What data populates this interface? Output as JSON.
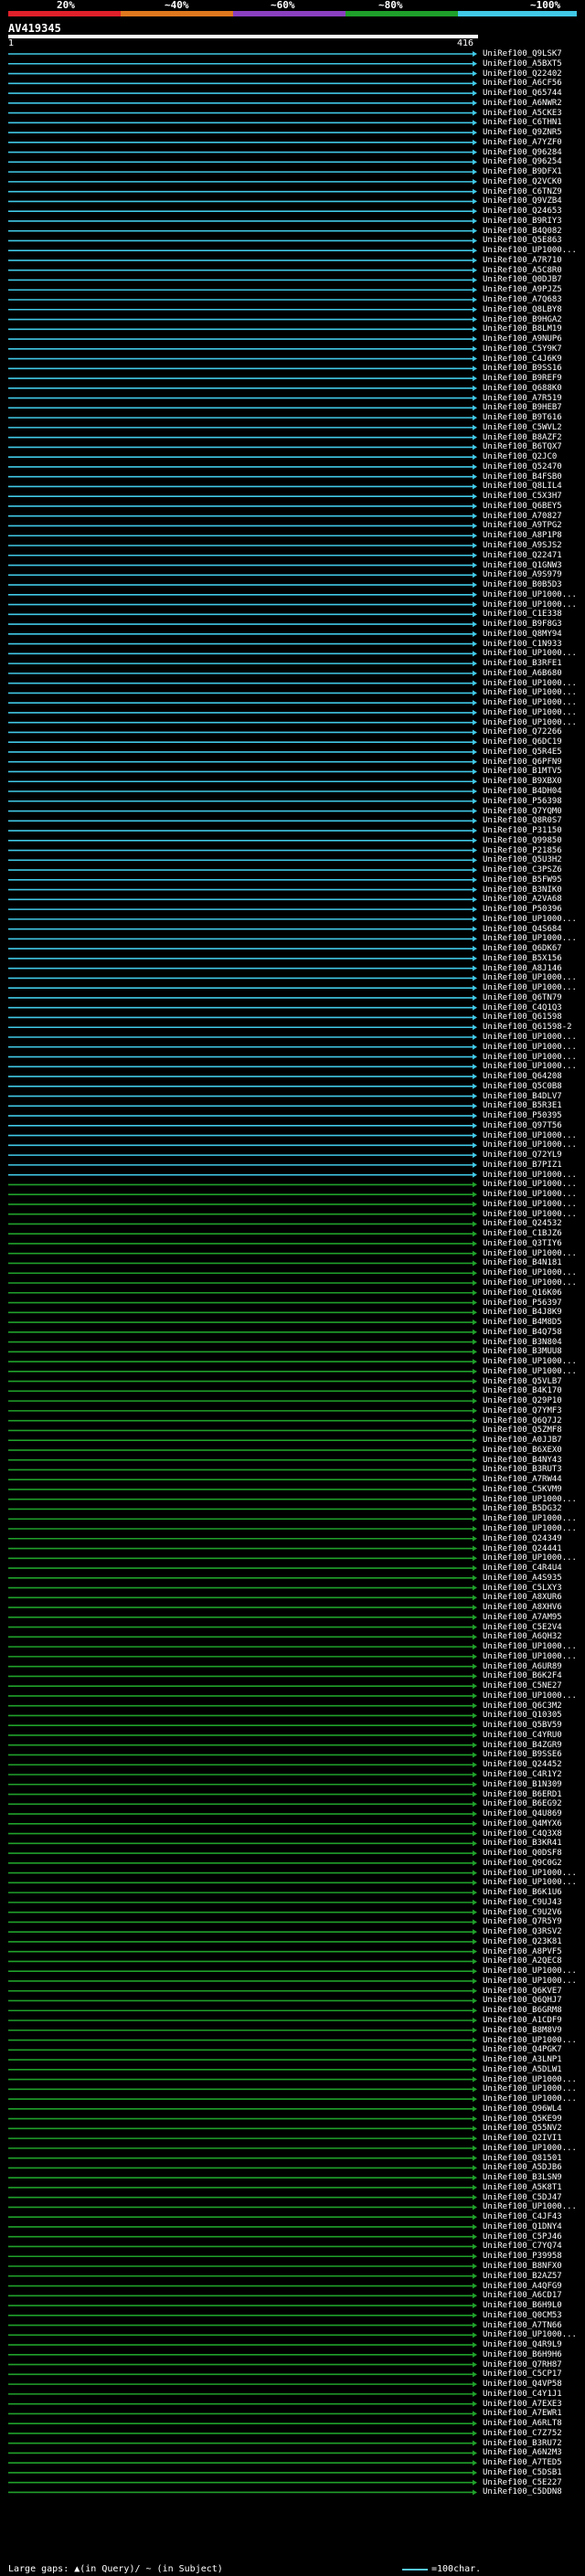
{
  "legend": {
    "labels": [
      "20%",
      "~40%",
      "~60%",
      "~80%",
      "~100%"
    ],
    "colors": [
      "#e0202a",
      "#e0781e",
      "#8a40c0",
      "#1fa02a",
      "#40c8e6"
    ]
  },
  "query": {
    "name": "AV419345",
    "start": "1",
    "end": "416"
  },
  "footer": {
    "gaps_text": "Large gaps: ▲(in Query)/ ~ (in Subject)",
    "scale_text": "=100char."
  },
  "hits": [
    "UniRef100_Q9LSK7",
    "UniRef100_A5BXT5",
    "UniRef100_Q22402",
    "UniRef100_A6CF56",
    "UniRef100_Q65744",
    "UniRef100_A6NWR2",
    "UniRef100_A5CKE3",
    "UniRef100_C6THN1",
    "UniRef100_Q9ZNR5",
    "UniRef100_A7YZF0",
    "UniRef100_Q96284",
    "UniRef100_Q96254",
    "UniRef100_B9DFX1",
    "UniRef100_Q2VCK0",
    "UniRef100_C6TNZ9",
    "UniRef100_Q9VZB4",
    "UniRef100_Q24653",
    "UniRef100_B9RIY3",
    "UniRef100_B4Q082",
    "UniRef100_Q5E863",
    "UniRef100_UP1000...",
    "UniRef100_A7R710",
    "UniRef100_A5C8R0",
    "UniRef100_Q0DJB7",
    "UniRef100_A9PJZ5",
    "UniRef100_A7Q683",
    "UniRef100_Q8LBY8",
    "UniRef100_B9HGA2",
    "UniRef100_B8LM19",
    "UniRef100_A9NUP6",
    "UniRef100_C5Y9K7",
    "UniRef100_C4J6K9",
    "UniRef100_B9SS16",
    "UniRef100_B9REF9",
    "UniRef100_Q688K0",
    "UniRef100_A7R519",
    "UniRef100_B9HEB7",
    "UniRef100_B9T616",
    "UniRef100_C5WVL2",
    "UniRef100_B8AZF2",
    "UniRef100_B6TQX7",
    "UniRef100_Q2JC0",
    "UniRef100_Q52470",
    "UniRef100_B4FSB0",
    "UniRef100_Q8LIL4",
    "UniRef100_C5X3H7",
    "UniRef100_Q6BEY5",
    "UniRef100_A70827",
    "UniRef100_A9TPG2",
    "UniRef100_A8P1P8",
    "UniRef100_A9SJS2",
    "UniRef100_Q22471",
    "UniRef100_Q1GNW3",
    "UniRef100_A9S979",
    "UniRef100_B0B5D3",
    "UniRef100_UP1000...",
    "UniRef100_UP1000...",
    "UniRef100_C1E338",
    "UniRef100_B9F8G3",
    "UniRef100_Q8MY94",
    "UniRef100_C1N933",
    "UniRef100_UP1000...",
    "UniRef100_B3RFE1",
    "UniRef100_A6B680",
    "UniRef100_UP1000...",
    "UniRef100_UP1000...",
    "UniRef100_UP1000...",
    "UniRef100_UP1000...",
    "UniRef100_UP1000...",
    "UniRef100_Q72266",
    "UniRef100_Q6DC19",
    "UniRef100_Q5R4E5",
    "UniRef100_Q6PFN9",
    "UniRef100_B1MTV5",
    "UniRef100_B9XBX0",
    "UniRef100_B4DH04",
    "UniRef100_P56398",
    "UniRef100_Q7YQM0",
    "UniRef100_Q8R0S7",
    "UniRef100_P31150",
    "UniRef100_Q99850",
    "UniRef100_P21856",
    "UniRef100_Q5U3H2",
    "UniRef100_C3PSZ6",
    "UniRef100_B5FW95",
    "UniRef100_B3NIK0",
    "UniRef100_A2VA68",
    "UniRef100_P50396",
    "UniRef100_UP1000...",
    "UniRef100_Q4S684",
    "UniRef100_UP1000...",
    "UniRef100_Q6DK67",
    "UniRef100_B5X156",
    "UniRef100_A8J146",
    "UniRef100_UP1000...",
    "UniRef100_UP1000...",
    "UniRef100_Q6TN79",
    "UniRef100_C4Q1Q3",
    "UniRef100_Q61598",
    "UniRef100_Q61598-2",
    "UniRef100_UP1000...",
    "UniRef100_UP1000...",
    "UniRef100_UP1000...",
    "UniRef100_UP1000...",
    "UniRef100_Q64208",
    "UniRef100_Q5C0B8",
    "UniRef100_B4DLV7",
    "UniRef100_B5R3E1",
    "UniRef100_P50395",
    "UniRef100_Q97T56",
    "UniRef100_UP1000...",
    "UniRef100_UP1000...",
    "UniRef100_Q72YL9",
    "UniRef100_B7PIZ1",
    "UniRef100_UP1000...",
    "UniRef100_UP1000...",
    "UniRef100_UP1000...",
    "UniRef100_UP1000...",
    "UniRef100_UP1000...",
    "UniRef100_Q24532",
    "UniRef100_C1BJZ6",
    "UniRef100_Q3TIY6",
    "UniRef100_UP1000...",
    "UniRef100_B4N181",
    "UniRef100_UP1000...",
    "UniRef100_UP1000...",
    "UniRef100_Q16K06",
    "UniRef100_P56397",
    "UniRef100_B4J8K9",
    "UniRef100_B4M8D5",
    "UniRef100_B4Q758",
    "UniRef100_B3N804",
    "UniRef100_B3MUU8",
    "UniRef100_UP1000...",
    "UniRef100_UP1000...",
    "UniRef100_Q5VLB7",
    "UniRef100_B4K170",
    "UniRef100_Q29P10",
    "UniRef100_Q7YMF3",
    "UniRef100_Q6Q7J2",
    "UniRef100_Q5ZMF8",
    "UniRef100_A0JJB7",
    "UniRef100_B6XEX0",
    "UniRef100_B4NY43",
    "UniRef100_B3RUT3",
    "UniRef100_A7RW44",
    "UniRef100_C5KVM9",
    "UniRef100_UP1000...",
    "UniRef100_B5DG32",
    "UniRef100_UP1000...",
    "UniRef100_UP1000...",
    "UniRef100_Q24349",
    "UniRef100_Q24441",
    "UniRef100_UP1000...",
    "UniRef100_C4R4U4",
    "UniRef100_A4S935",
    "UniRef100_C5LXY3",
    "UniRef100_A8XUR6",
    "UniRef100_A8XHV6",
    "UniRef100_A7AM95",
    "UniRef100_C5E2V4",
    "UniRef100_A6QH32",
    "UniRef100_UP1000...",
    "UniRef100_UP1000...",
    "UniRef100_A6UR89",
    "UniRef100_B6K2F4",
    "UniRef100_C5NE27",
    "UniRef100_UP1000...",
    "UniRef100_Q6C3M2",
    "UniRef100_Q10305",
    "UniRef100_Q5BV59",
    "UniRef100_C4YRU0",
    "UniRef100_B4ZGR9",
    "UniRef100_B9SSE6",
    "UniRef100_Q24452",
    "UniRef100_C4R1Y2",
    "UniRef100_B1N309",
    "UniRef100_B6ERD1",
    "UniRef100_B6EG92",
    "UniRef100_Q4U869",
    "UniRef100_Q4MYX6",
    "UniRef100_C4Q3X8",
    "UniRef100_B3KR41",
    "UniRef100_Q0DSF8",
    "UniRef100_Q9C0G2",
    "UniRef100_UP1000...",
    "UniRef100_UP1000...",
    "UniRef100_B6K1U6",
    "UniRef100_C9UJ43",
    "UniRef100_C9U2V6",
    "UniRef100_Q7R5Y9",
    "UniRef100_Q3RSV2",
    "UniRef100_Q23K81",
    "UniRef100_A8PVF5",
    "UniRef100_A2QEC8",
    "UniRef100_UP1000...",
    "UniRef100_UP1000...",
    "UniRef100_Q6KVE7",
    "UniRef100_Q6QHJ7",
    "UniRef100_B6GRM8",
    "UniRef100_A1CDF9",
    "UniRef100_B8M8V9",
    "UniRef100_UP1000...",
    "UniRef100_Q4PGK7",
    "UniRef100_A3LNP1",
    "UniRef100_A5DLW1",
    "UniRef100_UP1000...",
    "UniRef100_UP1000...",
    "UniRef100_UP1000...",
    "UniRef100_Q96WL4",
    "UniRef100_Q5KE99",
    "UniRef100_Q55NV2",
    "UniRef100_Q2IVI1",
    "UniRef100_UP1000...",
    "UniRef100_Q81501",
    "UniRef100_A5DJB6",
    "UniRef100_B3LSN9",
    "UniRef100_A5K8T1",
    "UniRef100_C5DJ47",
    "UniRef100_UP1000...",
    "UniRef100_C4JF43",
    "UniRef100_Q1DNY4",
    "UniRef100_C5PJ46",
    "UniRef100_C7YQ74",
    "UniRef100_P39958",
    "UniRef100_B8NFX0",
    "UniRef100_B2AZ57",
    "UniRef100_A4QFG9",
    "UniRef100_A6CD17",
    "UniRef100_B6H9L0",
    "UniRef100_Q0CM53",
    "UniRef100_A7TN66",
    "UniRef100_UP1000...",
    "UniRef100_Q4R9L9",
    "UniRef100_B6H9H6",
    "UniRef100_Q7RH87",
    "UniRef100_C5CP17",
    "UniRef100_Q4VP58",
    "UniRef100_C4Y1J1",
    "UniRef100_A7EXE3",
    "UniRef100_A7EWR1",
    "UniRef100_A6RLT8",
    "UniRef100_C7Z752",
    "UniRef100_B3RU72",
    "UniRef100_A6N2M3",
    "UniRef100_A7TED5",
    "UniRef100_C5DSB1",
    "UniRef100_C5E227",
    "UniRef100_C5DDN8"
  ]
}
